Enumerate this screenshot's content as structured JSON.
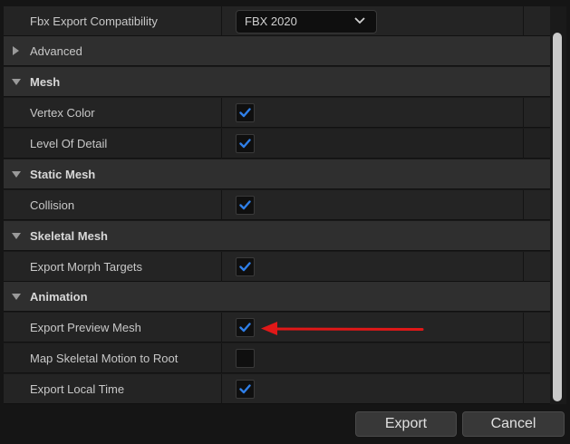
{
  "rows": [
    {
      "type": "prop",
      "label": "Fbx Export Compatibility",
      "control": "dropdown",
      "value": "FBX 2020"
    },
    {
      "type": "category",
      "label": "Advanced",
      "expanded": false
    },
    {
      "type": "category",
      "label": "Mesh",
      "expanded": true
    },
    {
      "type": "prop",
      "label": "Vertex Color",
      "control": "checkbox",
      "checked": true
    },
    {
      "type": "prop",
      "label": "Level Of Detail",
      "control": "checkbox",
      "checked": true
    },
    {
      "type": "category",
      "label": "Static Mesh",
      "expanded": true
    },
    {
      "type": "prop",
      "label": "Collision",
      "control": "checkbox",
      "checked": true
    },
    {
      "type": "category",
      "label": "Skeletal Mesh",
      "expanded": true
    },
    {
      "type": "prop",
      "label": "Export Morph Targets",
      "control": "checkbox",
      "checked": true
    },
    {
      "type": "category",
      "label": "Animation",
      "expanded": true
    },
    {
      "type": "prop",
      "label": "Export Preview Mesh",
      "control": "checkbox",
      "checked": true
    },
    {
      "type": "prop",
      "label": "Map Skeletal Motion to Root",
      "control": "checkbox",
      "checked": false
    },
    {
      "type": "prop",
      "label": "Export Local Time",
      "control": "checkbox",
      "checked": true
    }
  ],
  "buttons": {
    "export_label": "Export",
    "cancel_label": "Cancel"
  },
  "colors": {
    "check": "#2f7fe8",
    "arrow": "#e01818",
    "scroll_thumb": "#c9c9c9"
  },
  "icons": {
    "expanded": "triangle-down-icon",
    "collapsed": "triangle-right-icon",
    "dropdown": "chevron-down-icon",
    "check": "checkmark-icon"
  }
}
